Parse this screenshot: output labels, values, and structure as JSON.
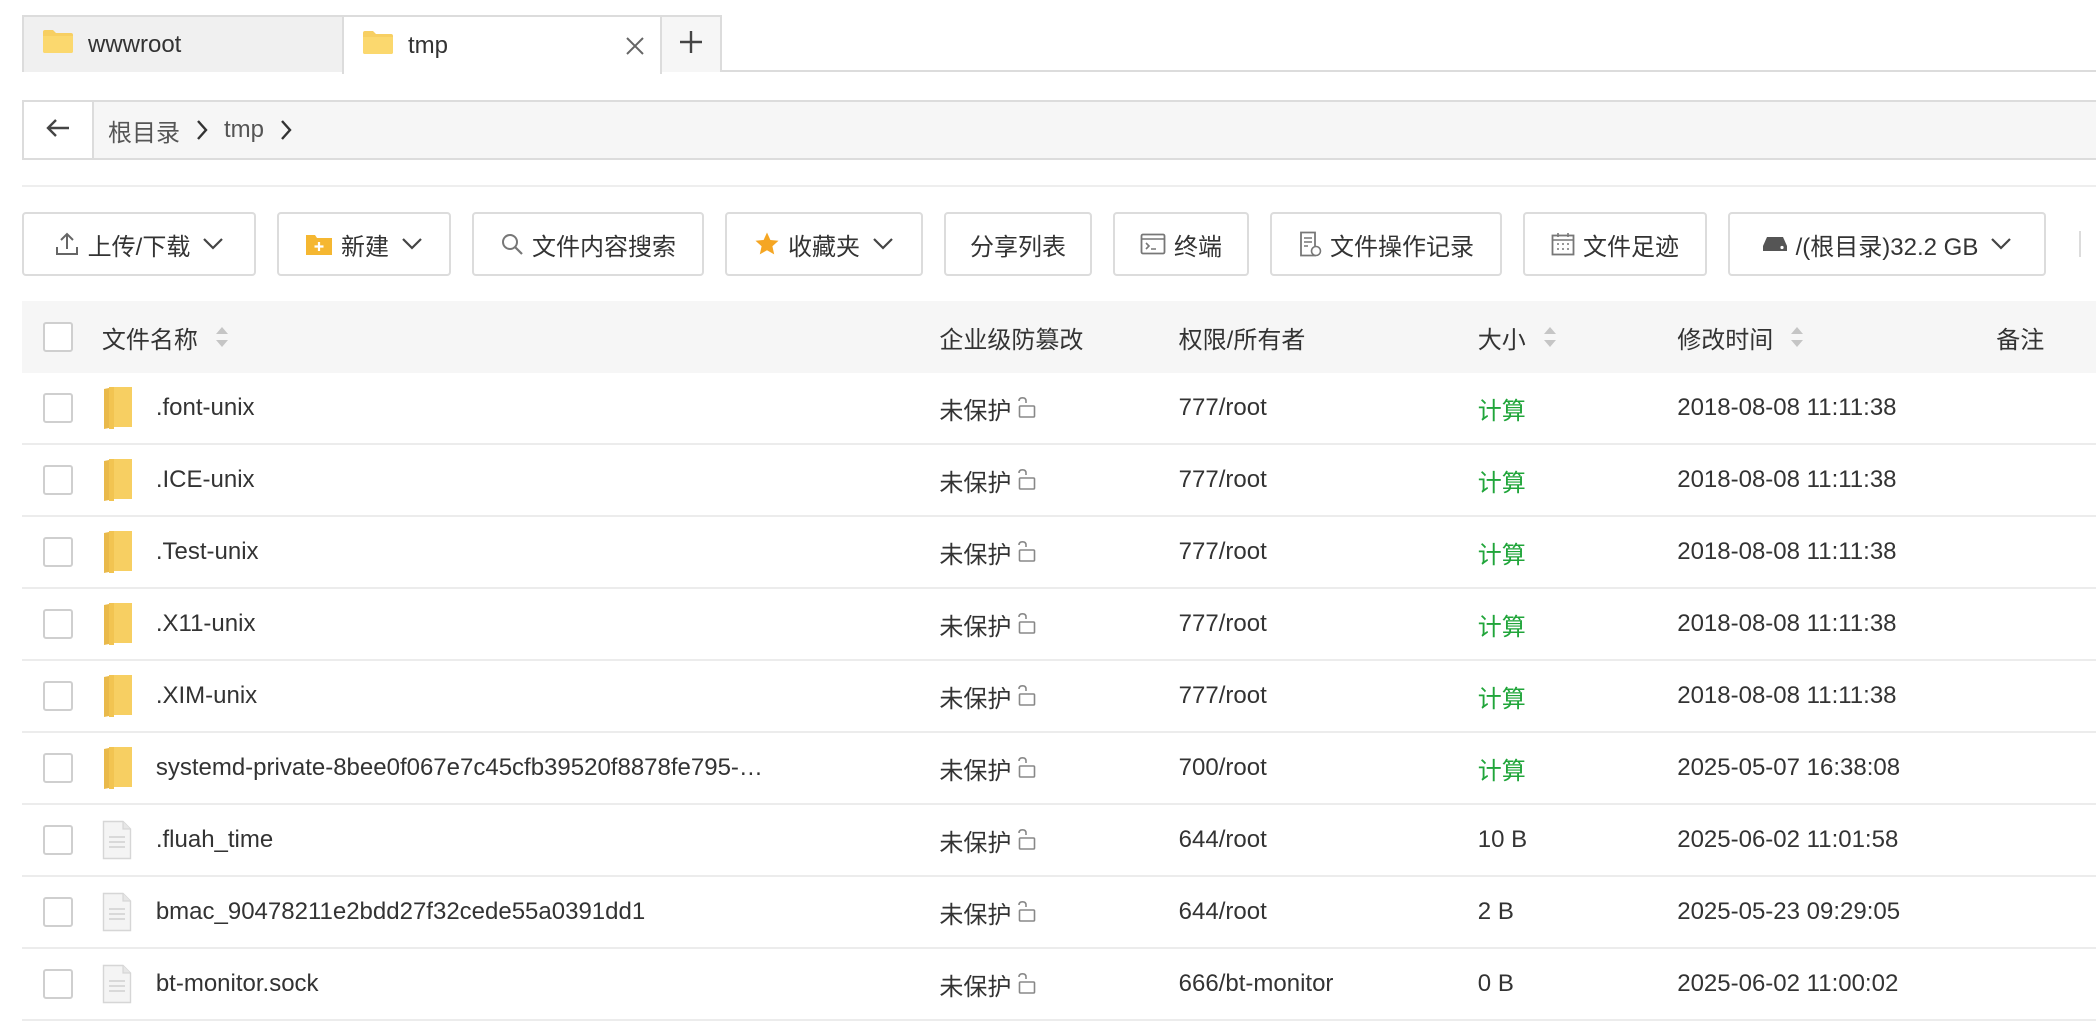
{
  "tabs": [
    {
      "label": "wwwroot",
      "active": false
    },
    {
      "label": "tmp",
      "active": true
    }
  ],
  "breadcrumb": [
    "根目录",
    "tmp"
  ],
  "toolbar": {
    "upload": "上传/下载",
    "new": "新建",
    "search": "文件内容搜索",
    "favorites": "收藏夹",
    "share": "分享列表",
    "terminal": "终端",
    "oplog": "文件操作记录",
    "footprint": "文件足迹",
    "disk": "/(根目录)32.2 GB"
  },
  "columns": {
    "name": "文件名称",
    "protect": "企业级防篡改",
    "perm": "权限/所有者",
    "size": "大小",
    "mtime": "修改时间",
    "note": "备注"
  },
  "rows": [
    {
      "type": "folder",
      "name": ".font-unix",
      "protect": "未保护",
      "perm": "777/root",
      "size": "计算",
      "mtime": "2018-08-08 11:11:38"
    },
    {
      "type": "folder",
      "name": ".ICE-unix",
      "protect": "未保护",
      "perm": "777/root",
      "size": "计算",
      "mtime": "2018-08-08 11:11:38"
    },
    {
      "type": "folder",
      "name": ".Test-unix",
      "protect": "未保护",
      "perm": "777/root",
      "size": "计算",
      "mtime": "2018-08-08 11:11:38"
    },
    {
      "type": "folder",
      "name": ".X11-unix",
      "protect": "未保护",
      "perm": "777/root",
      "size": "计算",
      "mtime": "2018-08-08 11:11:38"
    },
    {
      "type": "folder",
      "name": ".XIM-unix",
      "protect": "未保护",
      "perm": "777/root",
      "size": "计算",
      "mtime": "2018-08-08 11:11:38"
    },
    {
      "type": "folder",
      "name": "systemd-private-8bee0f067e7c45cfb39520f8878fe795-…",
      "protect": "未保护",
      "perm": "700/root",
      "size": "计算",
      "mtime": "2025-05-07 16:38:08"
    },
    {
      "type": "file",
      "name": ".fluah_time",
      "protect": "未保护",
      "perm": "644/root",
      "size": "10 B",
      "mtime": "2025-06-02 11:01:58"
    },
    {
      "type": "file",
      "name": "bmac_90478211e2bdd27f32cede55a0391dd1",
      "protect": "未保护",
      "perm": "644/root",
      "size": "2 B",
      "mtime": "2025-05-23 09:29:05"
    },
    {
      "type": "file",
      "name": "bt-monitor.sock",
      "protect": "未保护",
      "perm": "666/bt-monitor",
      "size": "0 B",
      "mtime": "2025-06-02 11:00:02"
    }
  ],
  "colors": {
    "accent": "#20a53a",
    "folder": "#f7cf62",
    "star": "#f5a623"
  }
}
